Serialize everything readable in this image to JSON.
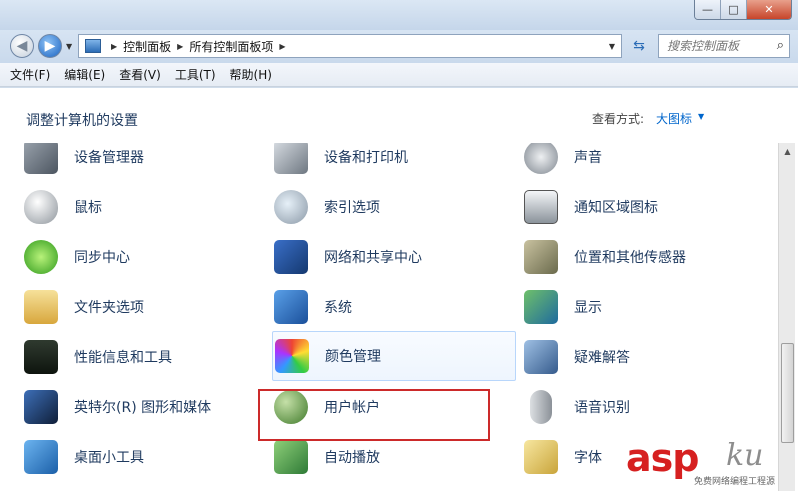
{
  "window": {
    "minimize_glyph": "—",
    "maximize_glyph": "□",
    "close_glyph": "✕"
  },
  "address_bar": {
    "crumbs": [
      "控制面板",
      "所有控制面板项"
    ],
    "search_placeholder": "搜索控制面板"
  },
  "menu": [
    "文件(F)",
    "编辑(E)",
    "查看(V)",
    "工具(T)",
    "帮助(H)"
  ],
  "header": {
    "title": "调整计算机的设置",
    "view_by_label": "查看方式:",
    "view_by_value": "大图标"
  },
  "items": [
    {
      "label": "设备管理器",
      "icon": "device-manager-icon"
    },
    {
      "label": "设备和打印机",
      "icon": "devices-printers-icon"
    },
    {
      "label": "声音",
      "icon": "sound-icon"
    },
    {
      "label": "鼠标",
      "icon": "mouse-icon"
    },
    {
      "label": "索引选项",
      "icon": "indexing-icon"
    },
    {
      "label": "通知区域图标",
      "icon": "notification-area-icon"
    },
    {
      "label": "同步中心",
      "icon": "sync-center-icon"
    },
    {
      "label": "网络和共享中心",
      "icon": "network-icon"
    },
    {
      "label": "位置和其他传感器",
      "icon": "location-sensors-icon"
    },
    {
      "label": "文件夹选项",
      "icon": "folder-options-icon"
    },
    {
      "label": "系统",
      "icon": "system-icon"
    },
    {
      "label": "显示",
      "icon": "display-icon"
    },
    {
      "label": "性能信息和工具",
      "icon": "performance-icon"
    },
    {
      "label": "颜色管理",
      "icon": "color-management-icon"
    },
    {
      "label": "疑难解答",
      "icon": "troubleshooting-icon"
    },
    {
      "label": "英特尔(R) 图形和媒体",
      "icon": "intel-graphics-icon"
    },
    {
      "label": "用户帐户",
      "icon": "user-accounts-icon"
    },
    {
      "label": "语音识别",
      "icon": "speech-recognition-icon"
    },
    {
      "label": "桌面小工具",
      "icon": "desktop-gadgets-icon"
    },
    {
      "label": "自动播放",
      "icon": "autoplay-icon"
    },
    {
      "label": "字体",
      "icon": "fonts-icon"
    }
  ],
  "watermark": {
    "brand_a": "asp",
    "brand_b": "ku",
    "sub": "免费网络编程工程源"
  }
}
